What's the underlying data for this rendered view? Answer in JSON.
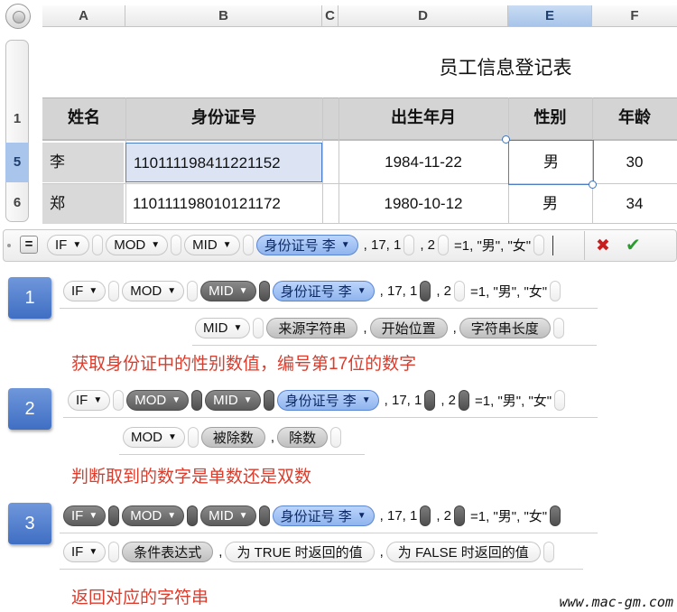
{
  "sheet": {
    "columns": [
      "A",
      "B",
      "C",
      "D",
      "E",
      "F"
    ],
    "rows": [
      "1",
      "5",
      "6"
    ],
    "title": "员工信息登记表",
    "headers": [
      "姓名",
      "身份证号",
      "出生年月",
      "性别",
      "年龄"
    ],
    "data": [
      {
        "name": "李",
        "id": "110111198411221152",
        "birth": "1984-11-22",
        "gender": "男",
        "age": "30"
      },
      {
        "name": "郑",
        "id": "110111198010121172",
        "birth": "1980-10-12",
        "gender": "男",
        "age": "34"
      }
    ]
  },
  "formula": {
    "if": "IF",
    "mod": "MOD",
    "mid": "MID",
    "ref": "身份证号 李",
    "mid_args": ", 17, 1",
    "mod_args": ", 2",
    "tail": "=1, \"男\", \"女\""
  },
  "steps": [
    {
      "num": "1",
      "signature_fn": "MID",
      "signature_args": [
        "来源字符串",
        "开始位置",
        "字符串长度"
      ],
      "note": "获取身份证中的性别数值，编号第17位的数字"
    },
    {
      "num": "2",
      "signature_fn": "MOD",
      "signature_args": [
        "被除数",
        "除数"
      ],
      "note": "判断取到的数字是单数还是双数"
    },
    {
      "num": "3",
      "signature_fn": "IF",
      "signature_args": [
        "条件表达式",
        "为 TRUE 时返回的值",
        "为 FALSE 时返回的值"
      ],
      "note": "返回对应的字符串"
    }
  ],
  "buttons": {
    "cancel": "✖",
    "accept": "✔",
    "equals": "="
  },
  "watermark": "www.mac-gm.com",
  "colors": {
    "selection": "#4d7fc6",
    "ref_pill": "#8fb4ee",
    "note_red": "#dd3b2b",
    "badge": "#3f6ec3",
    "accept": "#2f9a31",
    "cancel": "#c71f1f"
  }
}
